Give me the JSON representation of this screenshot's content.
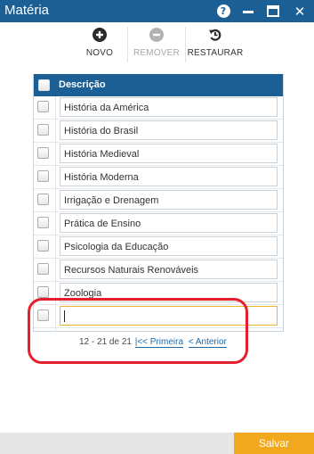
{
  "window": {
    "title": "Matéria",
    "help_glyph": "?",
    "close_glyph": "✕"
  },
  "toolbar": {
    "novo": {
      "label": "NOVO",
      "icon": "plus-circle-icon",
      "enabled": true
    },
    "remover": {
      "label": "REMOVER",
      "icon": "minus-circle-icon",
      "enabled": false
    },
    "restaurar": {
      "label": "RESTAURAR",
      "icon": "undo-icon",
      "enabled": true
    }
  },
  "grid": {
    "header": "Descrição",
    "rows": [
      "História da América",
      "História do Brasil",
      "História Medieval",
      "História Moderna",
      "Irrigação e Drenagem",
      "Prática de Ensino",
      "Psicologia da Educação",
      "Recursos Naturais Renováveis",
      "Zoologia",
      ""
    ]
  },
  "pager": {
    "range": "12 - 21 de 21",
    "first": "|<< Primeira",
    "previous": "< Anterior"
  },
  "footer": {
    "save": "Salvar"
  },
  "colors": {
    "header_blue": "#1b5f95",
    "accent_orange": "#f2a81d",
    "highlight_red": "#e5202d",
    "link_blue": "#1f6aa8"
  }
}
